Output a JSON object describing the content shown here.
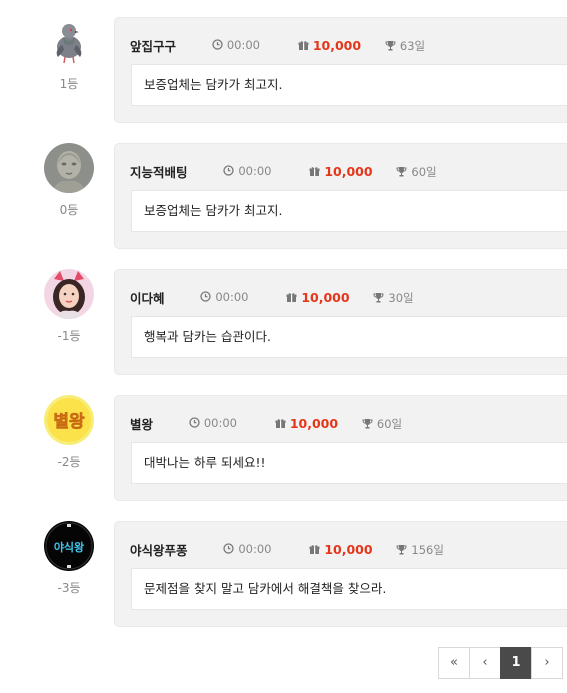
{
  "entries": [
    {
      "name": "앞집구구",
      "time": "00:00",
      "money": "10,000",
      "days": "63일",
      "rank": "1등",
      "message": "보증업체는 담카가 최고지."
    },
    {
      "name": "지능적배팅",
      "time": "00:00",
      "money": "10,000",
      "days": "60일",
      "rank": "0등",
      "message": "보증업체는 담카가 최고지."
    },
    {
      "name": "이다혜",
      "time": "00:00",
      "money": "10,000",
      "days": "30일",
      "rank": "-1등",
      "message": "행복과 담카는 습관이다."
    },
    {
      "name": "별왕",
      "time": "00:00",
      "money": "10,000",
      "days": "60일",
      "rank": "-2등",
      "message": "대박나는 하루 되세요!!"
    },
    {
      "name": "야식왕푸퐁",
      "time": "00:00",
      "money": "10,000",
      "days": "156일",
      "rank": "-3등",
      "message": "문제점을 찾지 말고 담카에서 해결책을 찾으라."
    }
  ],
  "avatars": {
    "star_text": "별왕",
    "night_text": "야식왕"
  },
  "pagination": {
    "first": "«",
    "prev": "‹",
    "current": "1",
    "next": "›"
  },
  "colors": {
    "money": "#e4361b",
    "card_bg": "#f2f2f2",
    "active_page_bg": "#4a4a4a"
  }
}
